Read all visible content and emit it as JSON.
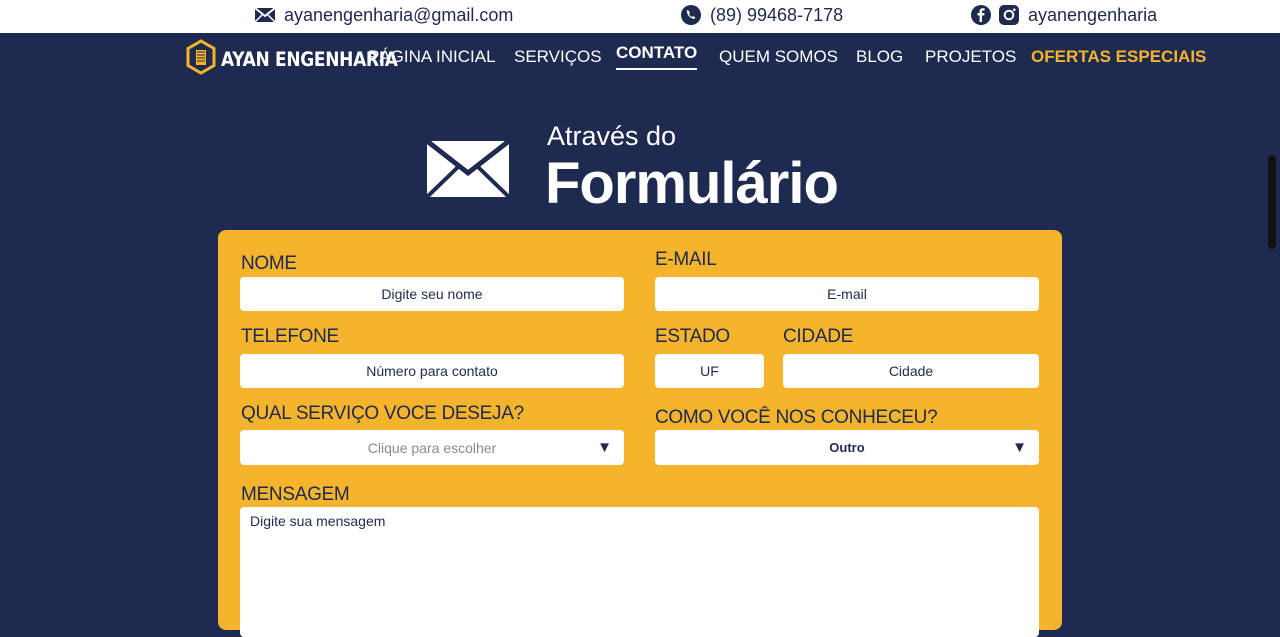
{
  "topbar": {
    "email": "ayanengenharia@gmail.com",
    "phone": "(89) 99468-7178",
    "social": "ayanengenharia"
  },
  "brand": {
    "name": "AYAN ENGENHARIA"
  },
  "nav": {
    "items": [
      "PÁGINA INICIAL",
      "SERVIÇOS",
      "CONTATO",
      "QUEM SOMOS",
      "BLOG",
      "PROJETOS",
      "OFERTAS ESPECIAIS"
    ],
    "active": "CONTATO"
  },
  "hero": {
    "subtitle": "Através do",
    "title": "Formulário"
  },
  "form": {
    "nome": {
      "label": "NOME",
      "placeholder": "Digite seu nome"
    },
    "email": {
      "label": "E-MAIL",
      "placeholder": "E-mail"
    },
    "telefone": {
      "label": "TELEFONE",
      "placeholder": "Número para contato"
    },
    "estado": {
      "label": "ESTADO",
      "placeholder": "UF"
    },
    "cidade": {
      "label": "CIDADE",
      "placeholder": "Cidade"
    },
    "servico": {
      "label": "QUAL SERVIÇO VOCE DESEJA?",
      "value": "Clique para escolher"
    },
    "conheceu": {
      "label": "COMO VOCÊ NOS CONHECEU?",
      "value": "Outro"
    },
    "mensagem": {
      "label": "MENSAGEM",
      "placeholder": "Digite sua mensagem"
    }
  },
  "colors": {
    "navy": "#1f2a51",
    "accent": "#f6b42c",
    "white": "#ffffff"
  },
  "icons": [
    "mail-icon",
    "whatsapp-icon",
    "facebook-icon",
    "instagram-icon",
    "envelope-icon",
    "chevron-down-icon"
  ]
}
